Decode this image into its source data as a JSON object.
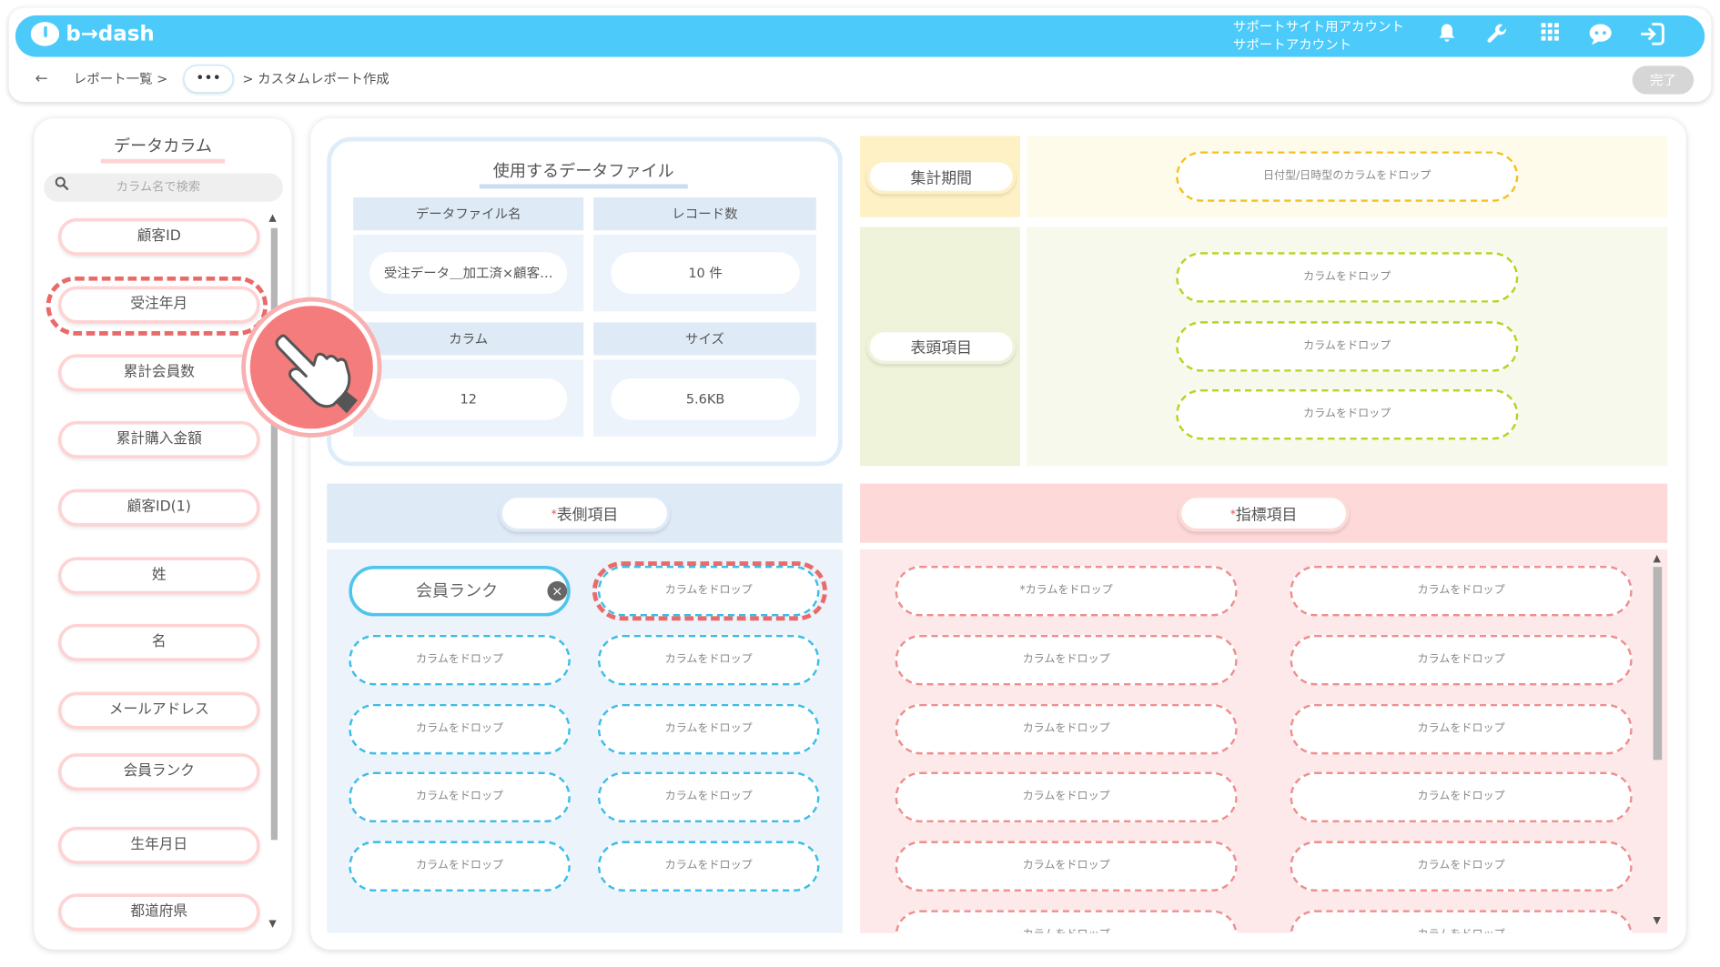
{
  "header": {
    "logo_text": "b→dash",
    "account_line1": "サポートサイト用アカウント",
    "account_line2": "サポートアカウント",
    "icons": [
      "bell-icon",
      "wrench-icon",
      "grid-icon",
      "chat-bot-icon",
      "logout-icon"
    ]
  },
  "breadcrumb": {
    "back_icon": "←",
    "item1": "レポート一覧 >",
    "more": "•••",
    "item2": "> カスタムレポート作成"
  },
  "done_button": "完了",
  "data_columns": {
    "title": "データカラム",
    "search_placeholder": "カラム名で検索",
    "items": [
      "顧客ID",
      "受注年月",
      "累計会員数",
      "累計購入金額",
      "顧客ID(1)",
      "姓",
      "名",
      "メールアドレス",
      "会員ランク",
      "生年月日",
      "都道府県"
    ]
  },
  "data_file": {
    "title": "使用するデータファイル",
    "file_name_label": "データファイル名",
    "file_name_value": "受注データ＿加工済×顧客…",
    "records_label": "レコード数",
    "records_value": "10 件",
    "columns_label": "カラム",
    "columns_value": "12",
    "size_label": "サイズ",
    "size_value": "5.6KB"
  },
  "period": {
    "label": "集計期間",
    "drop_text": "日付型/日時型のカラムをドロップ"
  },
  "header_items": {
    "label": "表頭項目",
    "drop_text": "カラムをドロップ"
  },
  "side_items": {
    "required_mark": "*",
    "label": "表側項目",
    "filled_value": "会員ランク",
    "clear_icon": "×",
    "drop_text": "カラムをドロップ"
  },
  "metric_items": {
    "required_mark": "*",
    "label": "指標項目",
    "first_drop_text": "*カラムをドロップ",
    "drop_text": "カラムをドロップ"
  },
  "colors": {
    "topbar": "#4ccbfb",
    "side_area": "#ecf3fb",
    "metric_area": "#fde9e9",
    "period_area": "#fefbea",
    "header_area": "#f6f9ec",
    "highlight": "#ea6a6a"
  }
}
